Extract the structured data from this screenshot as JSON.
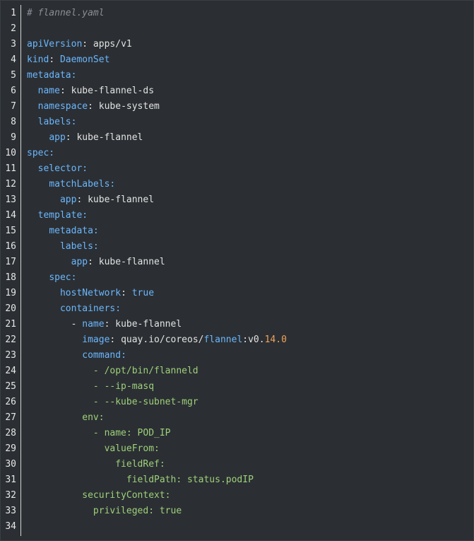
{
  "editor": {
    "filename_comment": "# flannel.yaml",
    "lines": [
      {
        "n": "1",
        "indent": "",
        "parts": [
          {
            "t": "# flannel.yaml",
            "c": "c"
          }
        ]
      },
      {
        "n": "2",
        "indent": "",
        "parts": []
      },
      {
        "n": "3",
        "indent": "",
        "parts": [
          {
            "t": "apiVersion",
            "c": "k"
          },
          {
            "t": ": apps/v1",
            "c": "v"
          }
        ]
      },
      {
        "n": "4",
        "indent": "",
        "parts": [
          {
            "t": "kind",
            "c": "k"
          },
          {
            "t": ": ",
            "c": "v"
          },
          {
            "t": "DaemonSet",
            "c": "k"
          }
        ]
      },
      {
        "n": "5",
        "indent": "",
        "parts": [
          {
            "t": "metadata:",
            "c": "k"
          }
        ]
      },
      {
        "n": "6",
        "indent": "  ",
        "parts": [
          {
            "t": "name",
            "c": "k"
          },
          {
            "t": ": kube-flannel-ds",
            "c": "v"
          }
        ]
      },
      {
        "n": "7",
        "indent": "  ",
        "parts": [
          {
            "t": "namespace",
            "c": "k"
          },
          {
            "t": ": kube-system",
            "c": "v"
          }
        ]
      },
      {
        "n": "8",
        "indent": "  ",
        "parts": [
          {
            "t": "labels:",
            "c": "k"
          }
        ]
      },
      {
        "n": "9",
        "indent": "    ",
        "parts": [
          {
            "t": "app",
            "c": "k"
          },
          {
            "t": ": kube-flannel",
            "c": "v"
          }
        ]
      },
      {
        "n": "10",
        "indent": "",
        "parts": [
          {
            "t": "spec:",
            "c": "k"
          }
        ]
      },
      {
        "n": "11",
        "indent": "  ",
        "parts": [
          {
            "t": "selector:",
            "c": "k"
          }
        ]
      },
      {
        "n": "12",
        "indent": "    ",
        "parts": [
          {
            "t": "matchLabels:",
            "c": "k"
          }
        ]
      },
      {
        "n": "13",
        "indent": "      ",
        "parts": [
          {
            "t": "app",
            "c": "k"
          },
          {
            "t": ": kube-flannel",
            "c": "v"
          }
        ]
      },
      {
        "n": "14",
        "indent": "  ",
        "parts": [
          {
            "t": "template:",
            "c": "k"
          }
        ]
      },
      {
        "n": "15",
        "indent": "    ",
        "parts": [
          {
            "t": "metadata:",
            "c": "k"
          }
        ]
      },
      {
        "n": "16",
        "indent": "      ",
        "parts": [
          {
            "t": "labels:",
            "c": "k"
          }
        ]
      },
      {
        "n": "17",
        "indent": "        ",
        "parts": [
          {
            "t": "app",
            "c": "k"
          },
          {
            "t": ": kube-flannel",
            "c": "v"
          }
        ]
      },
      {
        "n": "18",
        "indent": "    ",
        "parts": [
          {
            "t": "spec:",
            "c": "k"
          }
        ]
      },
      {
        "n": "19",
        "indent": "      ",
        "parts": [
          {
            "t": "hostNetwork",
            "c": "k"
          },
          {
            "t": ": ",
            "c": "v"
          },
          {
            "t": "true",
            "c": "kw"
          }
        ]
      },
      {
        "n": "20",
        "indent": "      ",
        "parts": [
          {
            "t": "containers:",
            "c": "k"
          }
        ]
      },
      {
        "n": "21",
        "indent": "        ",
        "parts": [
          {
            "t": "- ",
            "c": "v"
          },
          {
            "t": "name",
            "c": "k"
          },
          {
            "t": ": kube-flannel",
            "c": "v"
          }
        ]
      },
      {
        "n": "22",
        "indent": "          ",
        "parts": [
          {
            "t": "image",
            "c": "k"
          },
          {
            "t": ": quay.io/coreos/",
            "c": "v"
          },
          {
            "t": "flannel",
            "c": "k"
          },
          {
            "t": ":v0.",
            "c": "v"
          },
          {
            "t": "14.0",
            "c": "num"
          }
        ]
      },
      {
        "n": "23",
        "indent": "          ",
        "parts": [
          {
            "t": "command:",
            "c": "k"
          }
        ]
      },
      {
        "n": "24",
        "indent": "            ",
        "parts": [
          {
            "t": "- /opt/bin/flanneld",
            "c": "str"
          }
        ]
      },
      {
        "n": "25",
        "indent": "            ",
        "parts": [
          {
            "t": "- --ip-masq",
            "c": "str"
          }
        ]
      },
      {
        "n": "26",
        "indent": "            ",
        "parts": [
          {
            "t": "- --kube-subnet-mgr",
            "c": "str"
          }
        ]
      },
      {
        "n": "27",
        "indent": "          ",
        "parts": [
          {
            "t": "env:",
            "c": "str"
          }
        ]
      },
      {
        "n": "28",
        "indent": "            ",
        "parts": [
          {
            "t": "- name: POD_IP",
            "c": "str"
          }
        ]
      },
      {
        "n": "29",
        "indent": "              ",
        "parts": [
          {
            "t": "valueFrom:",
            "c": "str"
          }
        ]
      },
      {
        "n": "30",
        "indent": "                ",
        "parts": [
          {
            "t": "fieldRef:",
            "c": "str"
          }
        ]
      },
      {
        "n": "31",
        "indent": "                  ",
        "parts": [
          {
            "t": "fieldPath: status.podIP",
            "c": "str"
          }
        ]
      },
      {
        "n": "32",
        "indent": "          ",
        "parts": [
          {
            "t": "securityContext:",
            "c": "str"
          }
        ]
      },
      {
        "n": "33",
        "indent": "            ",
        "parts": [
          {
            "t": "privileged: true",
            "c": "str"
          }
        ]
      },
      {
        "n": "34",
        "indent": "",
        "parts": []
      }
    ]
  },
  "colors": {
    "background": "#2b2f33",
    "key": "#6bb7ff",
    "value": "#e2e2e2",
    "string": "#9ed07a",
    "number": "#f2a25c",
    "comment": "#8a8f96"
  }
}
